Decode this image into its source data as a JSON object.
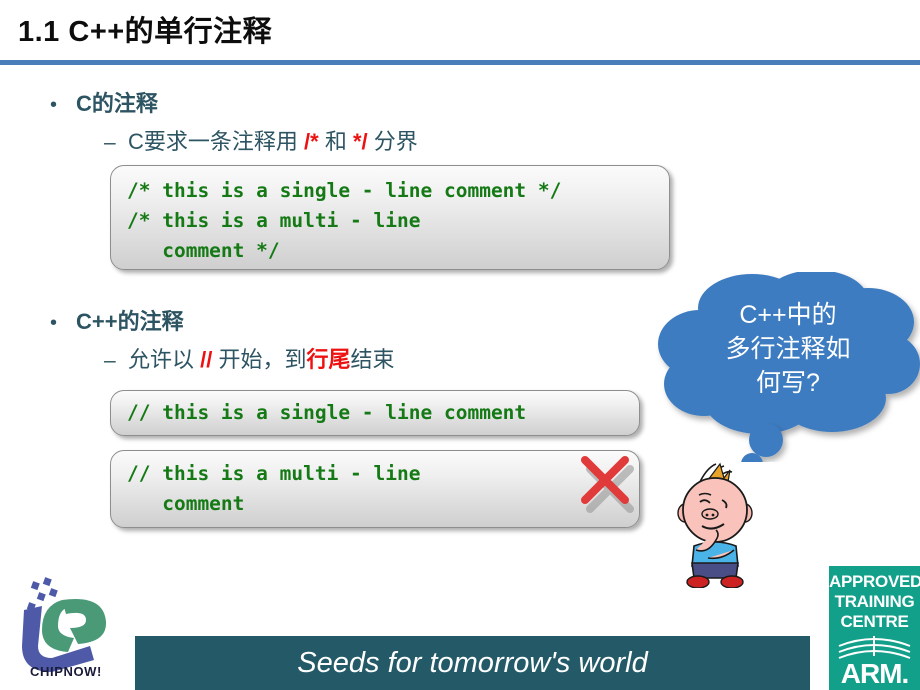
{
  "slide": {
    "title": "1.1 C++的单行注释",
    "rule_color": "#4a7ebb",
    "background": "#ffffff"
  },
  "sections": [
    {
      "bullet_marker": "•",
      "bullet_label": "C的注释",
      "sub_marker": "–",
      "sub_parts": [
        {
          "text": "C要求一条注释用 ",
          "color": "#2d5462"
        },
        {
          "text": "/*",
          "color": "#ee1111"
        },
        {
          "text": " 和 ",
          "color": "#2d5462"
        },
        {
          "text": "*/",
          "color": "#ee1111"
        },
        {
          "text": " 分界",
          "color": "#2d5462"
        }
      ],
      "sub_text_plain": "C要求一条注释用 /* 和 */ 分界",
      "code_box": {
        "lines": [
          "/* this is a single - line comment */",
          "/* this is a multi - line",
          "   comment */"
        ]
      }
    },
    {
      "bullet_marker": "•",
      "bullet_label": "C++的注释",
      "sub_marker": "–",
      "sub_parts": [
        {
          "text": "允许以 ",
          "color": "#2d5462"
        },
        {
          "text": "//",
          "color": "#ee1111"
        },
        {
          "text": " 开始，到",
          "color": "#2d5462"
        },
        {
          "text": "行尾",
          "color": "#ee1111"
        },
        {
          "text": "结束",
          "color": "#2d5462"
        }
      ],
      "sub_text_plain": "允许以 // 开始，到行尾结束",
      "code_box_ok": {
        "lines": [
          "// this is a single - line comment"
        ]
      },
      "code_box_bad": {
        "lines": [
          "// this is a multi - line",
          "   comment"
        ],
        "mark": "red-x",
        "mark_color": "#e03a3a"
      }
    }
  ],
  "thought_bubble": {
    "lines": [
      "C++中的",
      "多行注释如",
      "何写?"
    ],
    "fill_color": "#3e7cc0",
    "text_color": "#ffffff"
  },
  "character": {
    "name": "thinking-boy"
  },
  "footer": {
    "tagline": "Seeds for tomorrow's world",
    "bar_color": "#245a68",
    "text_color": "#ffffff"
  },
  "logos": {
    "chipnow": {
      "wordmark": "CHIPNOW!",
      "blue": "#4e5aa8",
      "green": "#4a9a78"
    },
    "arm_badge": {
      "line1": "APPROVED",
      "line2": "TRAINING",
      "line3": "CENTRE",
      "line4": "ARM.",
      "background": "#12a08a",
      "text_color": "#ffffff"
    }
  }
}
